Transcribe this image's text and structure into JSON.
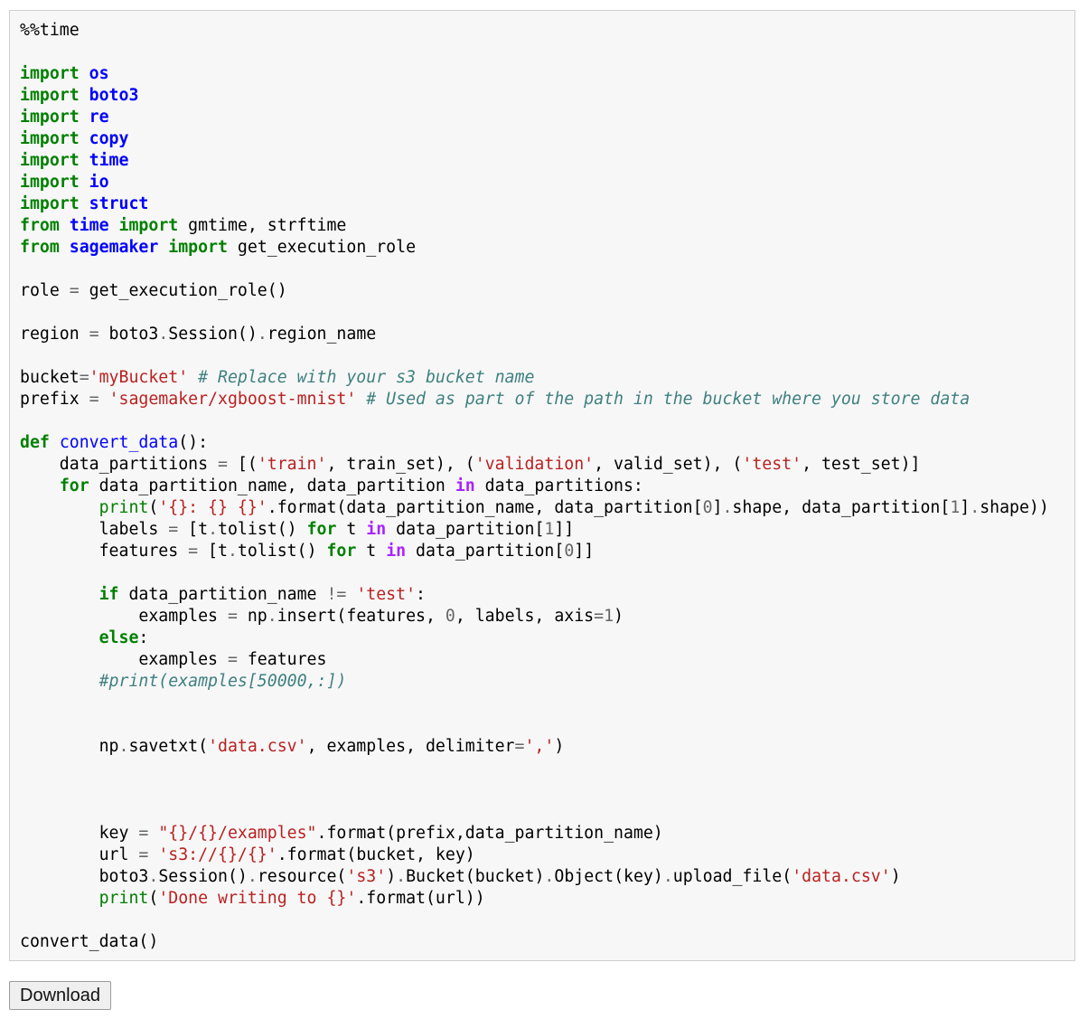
{
  "cell": {
    "lines": [
      [
        {
          "t": "%%time",
          "c": "magic"
        }
      ],
      [],
      [
        {
          "t": "import",
          "c": "kw"
        },
        {
          "t": " "
        },
        {
          "t": "os",
          "c": "mod"
        }
      ],
      [
        {
          "t": "import",
          "c": "kw"
        },
        {
          "t": " "
        },
        {
          "t": "boto3",
          "c": "mod"
        }
      ],
      [
        {
          "t": "import",
          "c": "kw"
        },
        {
          "t": " "
        },
        {
          "t": "re",
          "c": "mod"
        }
      ],
      [
        {
          "t": "import",
          "c": "kw"
        },
        {
          "t": " "
        },
        {
          "t": "copy",
          "c": "mod"
        }
      ],
      [
        {
          "t": "import",
          "c": "kw"
        },
        {
          "t": " "
        },
        {
          "t": "time",
          "c": "mod"
        }
      ],
      [
        {
          "t": "import",
          "c": "kw"
        },
        {
          "t": " "
        },
        {
          "t": "io",
          "c": "mod"
        }
      ],
      [
        {
          "t": "import",
          "c": "kw"
        },
        {
          "t": " "
        },
        {
          "t": "struct",
          "c": "mod"
        }
      ],
      [
        {
          "t": "from",
          "c": "kw"
        },
        {
          "t": " "
        },
        {
          "t": "time",
          "c": "mod"
        },
        {
          "t": " "
        },
        {
          "t": "import",
          "c": "kw"
        },
        {
          "t": " gmtime, strftime"
        }
      ],
      [
        {
          "t": "from",
          "c": "kw"
        },
        {
          "t": " "
        },
        {
          "t": "sagemaker",
          "c": "mod"
        },
        {
          "t": " "
        },
        {
          "t": "import",
          "c": "kw"
        },
        {
          "t": " get_execution_role"
        }
      ],
      [],
      [
        {
          "t": "role "
        },
        {
          "t": "=",
          "c": "op"
        },
        {
          "t": " get_execution_role()"
        }
      ],
      [],
      [
        {
          "t": "region "
        },
        {
          "t": "=",
          "c": "op"
        },
        {
          "t": " boto3"
        },
        {
          "t": ".",
          "c": "op"
        },
        {
          "t": "Session()"
        },
        {
          "t": ".",
          "c": "op"
        },
        {
          "t": "region_name"
        }
      ],
      [],
      [
        {
          "t": "bucket"
        },
        {
          "t": "=",
          "c": "op"
        },
        {
          "t": "'myBucket'",
          "c": "str"
        },
        {
          "t": " "
        },
        {
          "t": "# Replace with your s3 bucket name",
          "c": "cm"
        }
      ],
      [
        {
          "t": "prefix "
        },
        {
          "t": "=",
          "c": "op"
        },
        {
          "t": " "
        },
        {
          "t": "'sagemaker/xgboost-mnist'",
          "c": "str"
        },
        {
          "t": " "
        },
        {
          "t": "# Used as part of the path in the bucket where you store data",
          "c": "cm"
        }
      ],
      [],
      [
        {
          "t": "def",
          "c": "kw"
        },
        {
          "t": " "
        },
        {
          "t": "convert_data",
          "c": "fn"
        },
        {
          "t": "():"
        }
      ],
      [
        {
          "t": "    data_partitions "
        },
        {
          "t": "=",
          "c": "op"
        },
        {
          "t": " [("
        },
        {
          "t": "'train'",
          "c": "str"
        },
        {
          "t": ", train_set), ("
        },
        {
          "t": "'validation'",
          "c": "str"
        },
        {
          "t": ", valid_set), ("
        },
        {
          "t": "'test'",
          "c": "str"
        },
        {
          "t": ", test_set)]"
        }
      ],
      [
        {
          "t": "    "
        },
        {
          "t": "for",
          "c": "kw"
        },
        {
          "t": " data_partition_name, data_partition "
        },
        {
          "t": "in",
          "c": "ow"
        },
        {
          "t": " data_partitions:"
        }
      ],
      [
        {
          "t": "        "
        },
        {
          "t": "print",
          "c": "bi"
        },
        {
          "t": "("
        },
        {
          "t": "'{}: {} {}'",
          "c": "str"
        },
        {
          "t": "."
        },
        {
          "t": "format(data_partition_name, data_partition["
        },
        {
          "t": "0",
          "c": "num"
        },
        {
          "t": "]"
        },
        {
          "t": ".",
          "c": "op"
        },
        {
          "t": "shape, data_partition["
        },
        {
          "t": "1",
          "c": "num"
        },
        {
          "t": "]"
        },
        {
          "t": ".",
          "c": "op"
        },
        {
          "t": "shape))"
        }
      ],
      [
        {
          "t": "        labels "
        },
        {
          "t": "=",
          "c": "op"
        },
        {
          "t": " [t"
        },
        {
          "t": ".",
          "c": "op"
        },
        {
          "t": "tolist() "
        },
        {
          "t": "for",
          "c": "kw"
        },
        {
          "t": " t "
        },
        {
          "t": "in",
          "c": "ow"
        },
        {
          "t": " data_partition["
        },
        {
          "t": "1",
          "c": "num"
        },
        {
          "t": "]]"
        }
      ],
      [
        {
          "t": "        features "
        },
        {
          "t": "=",
          "c": "op"
        },
        {
          "t": " [t"
        },
        {
          "t": ".",
          "c": "op"
        },
        {
          "t": "tolist() "
        },
        {
          "t": "for",
          "c": "kw"
        },
        {
          "t": " t "
        },
        {
          "t": "in",
          "c": "ow"
        },
        {
          "t": " data_partition["
        },
        {
          "t": "0",
          "c": "num"
        },
        {
          "t": "]]"
        }
      ],
      [],
      [
        {
          "t": "        "
        },
        {
          "t": "if",
          "c": "kw"
        },
        {
          "t": " data_partition_name "
        },
        {
          "t": "!=",
          "c": "op"
        },
        {
          "t": " "
        },
        {
          "t": "'test'",
          "c": "str"
        },
        {
          "t": ":"
        }
      ],
      [
        {
          "t": "            examples "
        },
        {
          "t": "=",
          "c": "op"
        },
        {
          "t": " np"
        },
        {
          "t": ".",
          "c": "op"
        },
        {
          "t": "insert(features, "
        },
        {
          "t": "0",
          "c": "num"
        },
        {
          "t": ", labels, axis"
        },
        {
          "t": "=",
          "c": "op"
        },
        {
          "t": "1",
          "c": "num"
        },
        {
          "t": ")"
        }
      ],
      [
        {
          "t": "        "
        },
        {
          "t": "else",
          "c": "kw"
        },
        {
          "t": ":"
        }
      ],
      [
        {
          "t": "            examples "
        },
        {
          "t": "=",
          "c": "op"
        },
        {
          "t": " features"
        }
      ],
      [
        {
          "t": "        "
        },
        {
          "t": "#print(examples[50000,:])",
          "c": "cm"
        }
      ],
      [],
      [],
      [
        {
          "t": "        np"
        },
        {
          "t": ".",
          "c": "op"
        },
        {
          "t": "savetxt("
        },
        {
          "t": "'data.csv'",
          "c": "str"
        },
        {
          "t": ", examples, delimiter"
        },
        {
          "t": "=",
          "c": "op"
        },
        {
          "t": "','",
          "c": "str"
        },
        {
          "t": ")"
        }
      ],
      [],
      [],
      [],
      [
        {
          "t": "        key "
        },
        {
          "t": "=",
          "c": "op"
        },
        {
          "t": " "
        },
        {
          "t": "\"{}/{}/examples\"",
          "c": "str"
        },
        {
          "t": "."
        },
        {
          "t": "format(prefix,data_partition_name)"
        }
      ],
      [
        {
          "t": "        url "
        },
        {
          "t": "=",
          "c": "op"
        },
        {
          "t": " "
        },
        {
          "t": "'s3://{}/{}'",
          "c": "str"
        },
        {
          "t": "."
        },
        {
          "t": "format(bucket, key)"
        }
      ],
      [
        {
          "t": "        boto3"
        },
        {
          "t": ".",
          "c": "op"
        },
        {
          "t": "Session()"
        },
        {
          "t": ".",
          "c": "op"
        },
        {
          "t": "resource("
        },
        {
          "t": "'s3'",
          "c": "str"
        },
        {
          "t": ")"
        },
        {
          "t": ".",
          "c": "op"
        },
        {
          "t": "Bucket(bucket)"
        },
        {
          "t": ".",
          "c": "op"
        },
        {
          "t": "Object(key)"
        },
        {
          "t": ".",
          "c": "op"
        },
        {
          "t": "upload_file("
        },
        {
          "t": "'data.csv'",
          "c": "str"
        },
        {
          "t": ")"
        }
      ],
      [
        {
          "t": "        "
        },
        {
          "t": "print",
          "c": "bi"
        },
        {
          "t": "("
        },
        {
          "t": "'Done writing to {}'",
          "c": "str"
        },
        {
          "t": "."
        },
        {
          "t": "format(url))"
        }
      ],
      [],
      [
        {
          "t": "convert_data()"
        }
      ]
    ]
  },
  "download": {
    "label": "Download"
  }
}
